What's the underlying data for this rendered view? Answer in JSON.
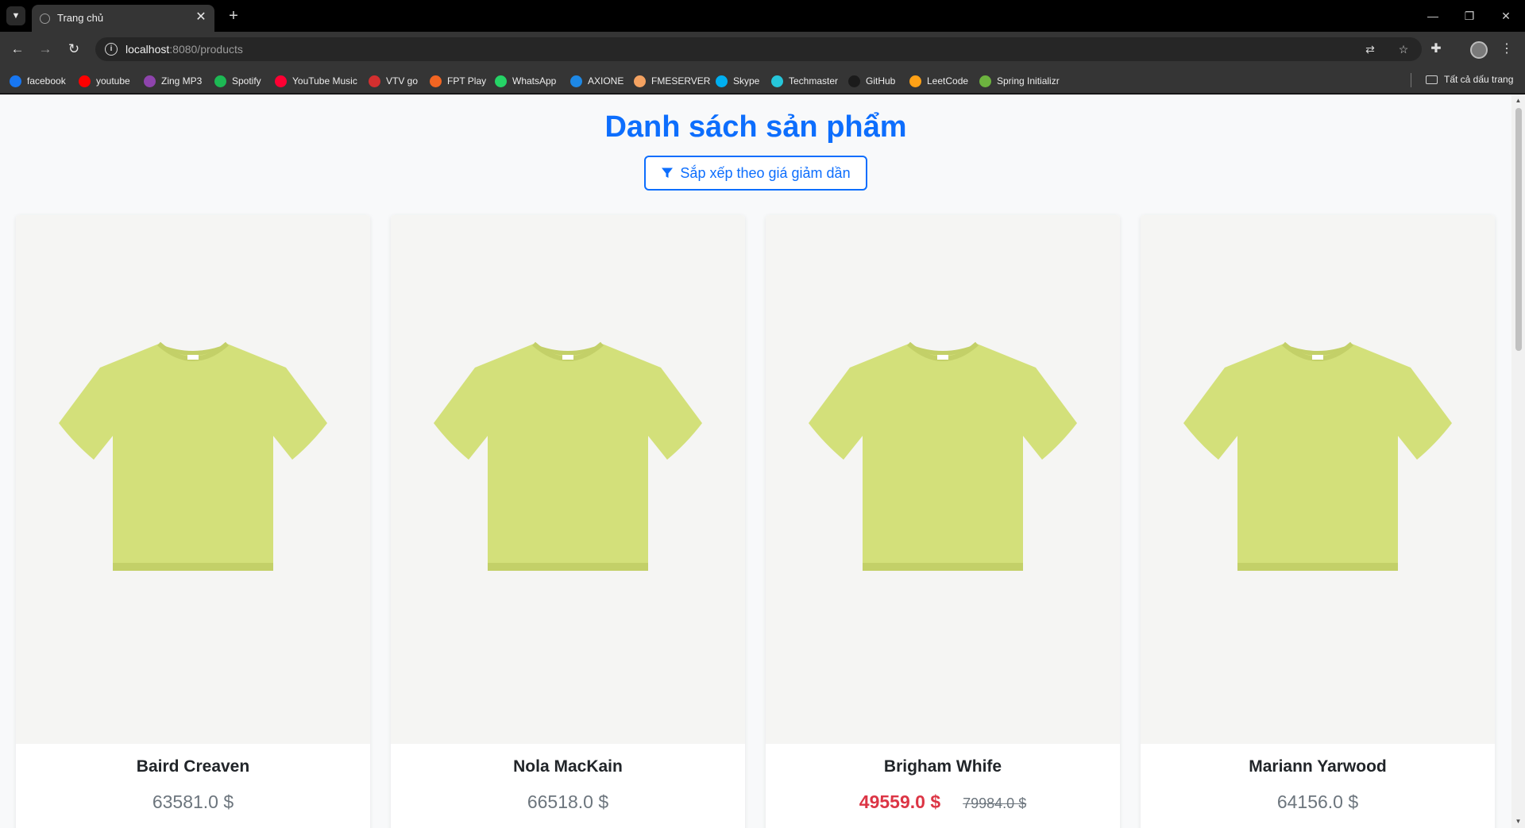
{
  "browser": {
    "tab_title": "Trang chủ",
    "url_host": "localhost",
    "url_path": ":8080/products",
    "bookmarks": [
      {
        "label": "facebook",
        "color": "#1877f2"
      },
      {
        "label": "youtube",
        "color": "#ff0000"
      },
      {
        "label": "Zing MP3",
        "color": "#8e44ad"
      },
      {
        "label": "Spotify",
        "color": "#1db954"
      },
      {
        "label": "YouTube Music",
        "color": "#ff0033"
      },
      {
        "label": "VTV go",
        "color": "#d32f2f"
      },
      {
        "label": "FPT Play",
        "color": "#f26522"
      },
      {
        "label": "WhatsApp",
        "color": "#25d366"
      },
      {
        "label": "AXIONE",
        "color": "#1e88e5"
      },
      {
        "label": "FMESERVER",
        "color": "#f4a261"
      },
      {
        "label": "Skype",
        "color": "#00aff0"
      },
      {
        "label": "Techmaster",
        "color": "#26c6da"
      },
      {
        "label": "GitHub",
        "color": "#1b1b1b"
      },
      {
        "label": "LeetCode",
        "color": "#ffa116"
      },
      {
        "label": "Spring Initializr",
        "color": "#6db33f"
      }
    ],
    "all_bookmarks_label": "Tất cả dấu trang"
  },
  "page": {
    "title": "Danh sách sản phẩm",
    "sort_button_label": "Sắp xếp theo giá giảm dần",
    "accent_color": "#0d6efd",
    "sale_color": "#dc3545",
    "product_color": "#d3e07a",
    "products": [
      {
        "name": "Baird Creaven",
        "price": "63581.0 $",
        "sale_price": "",
        "old_price": ""
      },
      {
        "name": "Nola MacKain",
        "price": "66518.0 $",
        "sale_price": "",
        "old_price": ""
      },
      {
        "name": "Brigham Whife",
        "price": "",
        "sale_price": "49559.0 $",
        "old_price": "79984.0 $"
      },
      {
        "name": "Mariann Yarwood",
        "price": "64156.0 $",
        "sale_price": "",
        "old_price": ""
      }
    ]
  }
}
